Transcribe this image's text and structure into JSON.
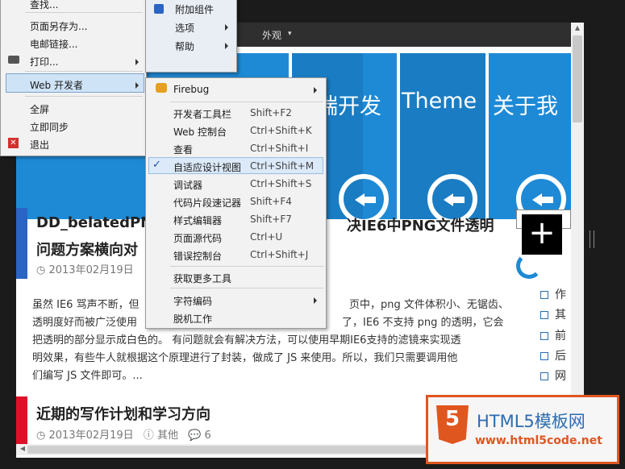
{
  "page": {
    "nav_item": "外观",
    "hero_titles": [
      "端开发",
      "Theme",
      "关于我"
    ],
    "plus_button": "+",
    "posts": [
      {
        "title_line1": "DD_belatedPN",
        "title_line1_right": "决IE6中PNG文件透明",
        "title_line2": "问题方案横向对",
        "date": "2013年02月19日",
        "excerpt": [
          "虽然 IE6 骂声不断，但",
          "页中，png 文件体积小、无锯齿、",
          "透明度好而被广泛使用",
          "了，IE6 不支持 png 的透明，它会",
          "把透明的部分显示成白色的。 有问题就会有解决方法，可以使用早期IE6支持的滤镜来实现透",
          "明效果，有些牛人就根据这个原理进行了封装，做成了 JS 来使用。所以，我们只需要调用他",
          "们编写 JS 文件即可。..."
        ]
      },
      {
        "title": "近期的写作计划和学习方向",
        "date": "2013年02月19日",
        "category": "其他",
        "comments": "6"
      }
    ],
    "sidebar_items": [
      "作",
      "其",
      "前",
      "后",
      "网"
    ]
  },
  "main_menu": {
    "items": [
      {
        "label": "查找...",
        "icon": ""
      },
      {
        "label": "页面另存为...",
        "icon": ""
      },
      {
        "label": "电邮链接...",
        "icon": ""
      },
      {
        "label": "打印...",
        "icon": "printer-icon"
      },
      {
        "label": "Web 开发者",
        "icon": ""
      },
      {
        "label": "全屏",
        "icon": ""
      },
      {
        "label": "立即同步",
        "icon": ""
      },
      {
        "label": "退出",
        "icon": "exit-icon"
      }
    ],
    "right_items": [
      {
        "label": "附加组件",
        "icon": "puzzle-icon"
      },
      {
        "label": "选项",
        "icon": ""
      },
      {
        "label": "帮助",
        "icon": ""
      }
    ]
  },
  "dev_menu": {
    "items": [
      {
        "label": "Firebug",
        "shortcut": "",
        "icon": "firebug-icon"
      },
      {
        "label": "开发者工具栏",
        "shortcut": "Shift+F2"
      },
      {
        "label": "Web 控制台",
        "shortcut": "Ctrl+Shift+K"
      },
      {
        "label": "查看",
        "shortcut": "Ctrl+Shift+I"
      },
      {
        "label": "自适应设计视图",
        "shortcut": "Ctrl+Shift+M",
        "checked": true
      },
      {
        "label": "调试器",
        "shortcut": "Ctrl+Shift+S"
      },
      {
        "label": "代码片段速记器",
        "shortcut": "Shift+F4"
      },
      {
        "label": "样式编辑器",
        "shortcut": "Shift+F7"
      },
      {
        "label": "页面源代码",
        "shortcut": "Ctrl+U"
      },
      {
        "label": "错误控制台",
        "shortcut": "Ctrl+Shift+J"
      },
      {
        "label": "获取更多工具",
        "shortcut": ""
      },
      {
        "label": "字符编码",
        "shortcut": ""
      },
      {
        "label": "脱机工作",
        "shortcut": ""
      }
    ]
  },
  "watermark": {
    "title": "HTML5模板网",
    "url": "www.html5code.net",
    "badge_num": "5"
  },
  "colors": {
    "accent_blue": "#1e8ad6",
    "post_bar_blue": "#2a64c4",
    "post_bar_red": "#e0102a",
    "watermark_orange": "#e0561f"
  }
}
